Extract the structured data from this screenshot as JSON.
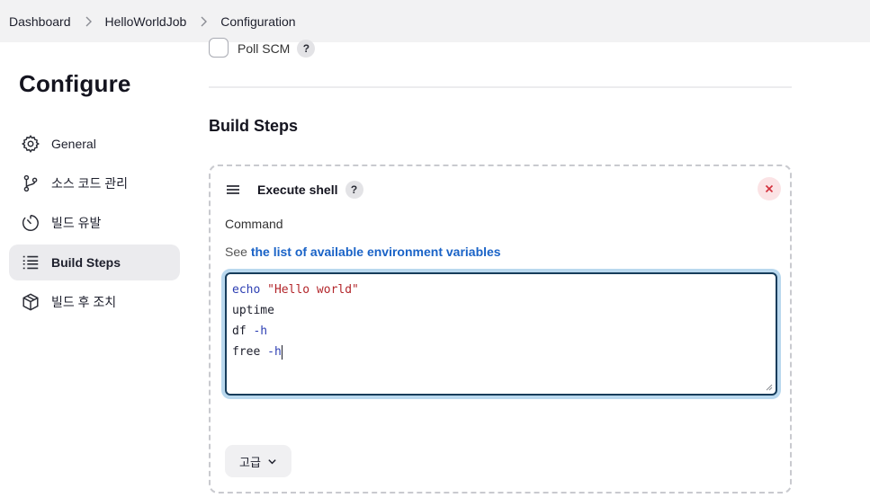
{
  "breadcrumb": {
    "items": [
      "Dashboard",
      "HelloWorldJob",
      "Configuration"
    ]
  },
  "sidebar": {
    "title": "Configure",
    "items": [
      {
        "label": "General",
        "icon": "gear-icon"
      },
      {
        "label": "소스 코드 관리",
        "icon": "branch-icon"
      },
      {
        "label": "빌드 유발",
        "icon": "timer-icon"
      },
      {
        "label": "Build Steps",
        "icon": "list-icon",
        "active": true
      },
      {
        "label": "빌드 후 조치",
        "icon": "package-icon"
      }
    ]
  },
  "main": {
    "poll_scm": {
      "label": "Poll SCM",
      "checked": false,
      "help": "?"
    },
    "section_title": "Build Steps",
    "step": {
      "title": "Execute shell",
      "help": "?",
      "close_icon": "close-icon",
      "command_label": "Command",
      "env_prefix": "See",
      "env_link": "the list of available environment variables",
      "code_lines": [
        {
          "a": "echo",
          "b": " ",
          "c": "\"Hello world\""
        },
        {
          "a": "uptime",
          "b": "",
          "c": ""
        },
        {
          "a": "df ",
          "b": "-h",
          "c": ""
        },
        {
          "a": "free ",
          "b": "-h",
          "c": ""
        }
      ],
      "advanced_label": "고급"
    }
  },
  "colors": {
    "link": "#1a63c7",
    "active_nav_bg": "#ebebee",
    "focus_ring": "#b9d8ee",
    "close_bg": "#fbe3e5",
    "close_fg": "#d3303c"
  }
}
